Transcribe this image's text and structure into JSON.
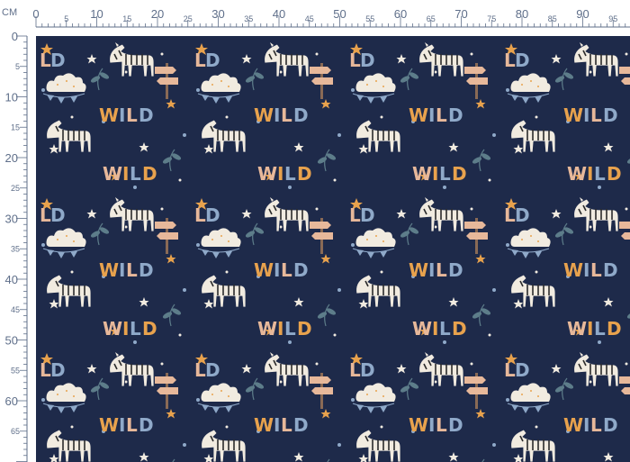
{
  "ruler": {
    "unit_label": "CM",
    "top_major": [
      "0",
      "10",
      "20",
      "30",
      "40",
      "50",
      "60",
      "70",
      "80",
      "90"
    ],
    "top_minor": [
      "5",
      "15",
      "25",
      "35",
      "45",
      "55",
      "65",
      "75",
      "85",
      "95"
    ],
    "left_major": [
      "0",
      "10",
      "20",
      "30",
      "40",
      "50",
      "60"
    ],
    "left_minor": [
      "5",
      "15",
      "25",
      "35",
      "45",
      "55",
      "65"
    ],
    "color": "#5f6f8a"
  },
  "fabric": {
    "background_color": "#1e2a4a",
    "motif_text": "WILD",
    "palette": {
      "orange": "#e8a24d",
      "peach": "#e7b89a",
      "blue": "#8fa9c9",
      "cream": "#f1ebe0",
      "leaf": "#5d7d8a",
      "brown": "#8a6a55"
    }
  }
}
